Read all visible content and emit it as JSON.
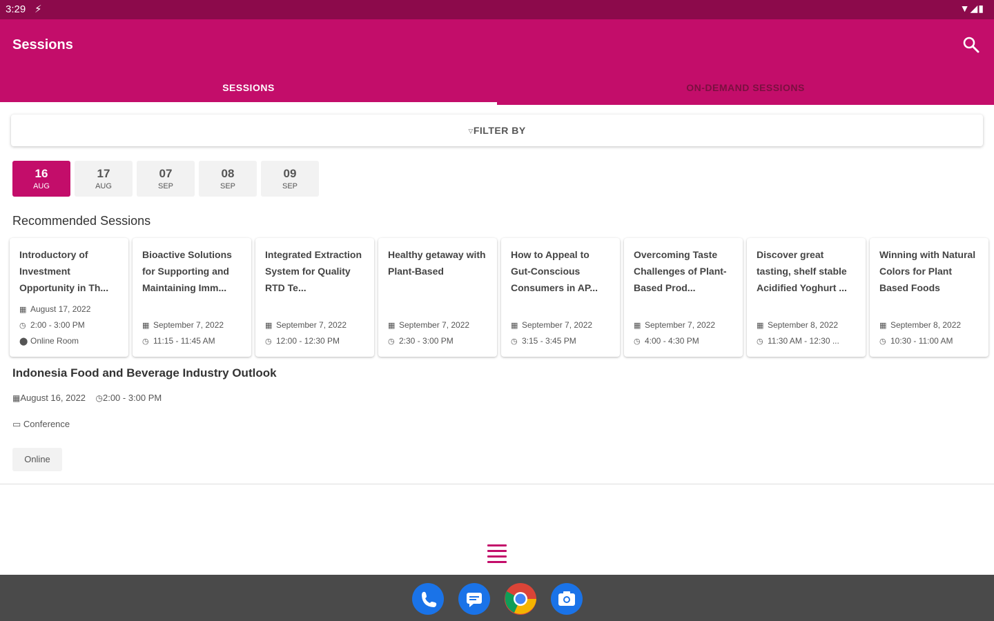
{
  "status_bar": {
    "time": "3:29",
    "charging_icon": "lightning-icon",
    "system_icons": [
      "wifi-icon",
      "signal-icon",
      "battery-icon"
    ]
  },
  "app_bar": {
    "title": "Sessions",
    "search_icon": "search-icon",
    "color": "#c30d6a"
  },
  "tabs": [
    {
      "label": "SESSIONS",
      "active": true
    },
    {
      "label": "ON-DEMAND SESSIONS",
      "active": false
    }
  ],
  "filter": {
    "label": "FILTER BY",
    "icon": "filter-icon"
  },
  "dates": [
    {
      "day": "16",
      "month": "AUG",
      "active": true
    },
    {
      "day": "17",
      "month": "AUG",
      "active": false
    },
    {
      "day": "07",
      "month": "SEP",
      "active": false
    },
    {
      "day": "08",
      "month": "SEP",
      "active": false
    },
    {
      "day": "09",
      "month": "SEP",
      "active": false
    }
  ],
  "recommended": {
    "heading": "Recommended Sessions",
    "cards": [
      {
        "title": "Introductory of Investment Opportunity in Th...",
        "date": "August 17, 2022",
        "time": "2:00 - 3:00 PM",
        "location": "Online Room"
      },
      {
        "title": "Bioactive Solutions for Supporting and Maintaining Imm...",
        "date": "September 7, 2022",
        "time": "11:15 - 11:45 AM"
      },
      {
        "title": "Integrated Extraction System for Quality RTD Te...",
        "date": "September 7, 2022",
        "time": "12:00 - 12:30 PM"
      },
      {
        "title": "Healthy getaway with Plant-Based",
        "date": "September 7, 2022",
        "time": "2:30 - 3:00 PM"
      },
      {
        "title": "How to Appeal to Gut-Conscious Consumers in AP...",
        "date": "September 7, 2022",
        "time": "3:15 - 3:45 PM"
      },
      {
        "title": "Overcoming Taste Challenges of Plant-Based Prod...",
        "date": "September 7, 2022",
        "time": "4:00 - 4:30 PM"
      },
      {
        "title": "Discover great tasting, shelf stable Acidified Yoghurt ...",
        "date": "September 8, 2022",
        "time": "11:30 AM - 12:30 ..."
      },
      {
        "title": "Winning with Natural Colors for Plant Based Foods",
        "date": "September 8, 2022",
        "time": "10:30 - 11:00 AM"
      }
    ]
  },
  "featured": {
    "title": "Indonesia Food and Beverage Industry Outlook",
    "date": "August 16, 2022",
    "time": "2:00 - 3:00 PM",
    "type": "Conference",
    "tag": "Online"
  },
  "bottom": {
    "menu_icon": "hamburger-menu-icon"
  },
  "dock": [
    "phone-icon",
    "messages-icon",
    "chrome-icon",
    "camera-icon"
  ]
}
